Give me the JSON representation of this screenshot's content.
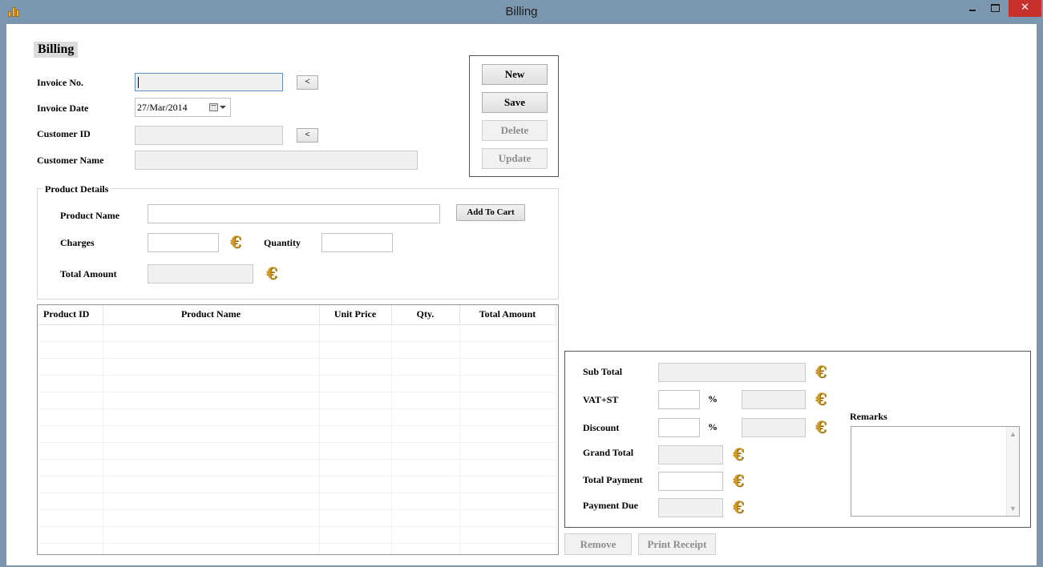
{
  "window": {
    "title": "Billing",
    "close_glyph": "✕"
  },
  "form": {
    "heading": "Billing",
    "invoice_no_label": "Invoice No.",
    "invoice_no_value": "",
    "invoice_date_label": "Invoice Date",
    "invoice_date_value": "27/Mar/2014",
    "customer_id_label": "Customer ID",
    "customer_name_label": "Customer Name",
    "lookup_button_label": "<"
  },
  "actions": {
    "new": "New",
    "save": "Save",
    "delete": "Delete",
    "update": "Update"
  },
  "product_details": {
    "legend": "Product Details",
    "product_name_label": "Product Name",
    "add_to_cart": "Add To Cart",
    "charges_label": "Charges",
    "quantity_label": "Quantity",
    "total_amount_label": "Total Amount",
    "currency_symbol": "€"
  },
  "grid": {
    "columns": [
      "Product ID",
      "Product Name",
      "Unit Price",
      "Qty.",
      "Total Amount"
    ],
    "rows": []
  },
  "totals": {
    "sub_total_label": "Sub Total",
    "vat_label": "VAT+ST",
    "discount_label": "Discount",
    "percent_symbol": "%",
    "grand_total_label": "Grand Total",
    "total_payment_label": "Total Payment",
    "payment_due_label": "Payment Due",
    "remarks_label": "Remarks",
    "currency_symbol": "€"
  },
  "bottom": {
    "remove": "Remove",
    "print_receipt": "Print Receipt"
  },
  "colors": {
    "title_bar": "#7b96af",
    "close_button": "#c7302b",
    "euro_icon": "#d19a22"
  },
  "icons": [
    "app-icon",
    "minimize-icon",
    "maximize-icon",
    "close-icon",
    "calendar-icon",
    "dropdown-arrow-icon",
    "euro-icon",
    "scroll-up-icon",
    "scroll-down-icon"
  ]
}
